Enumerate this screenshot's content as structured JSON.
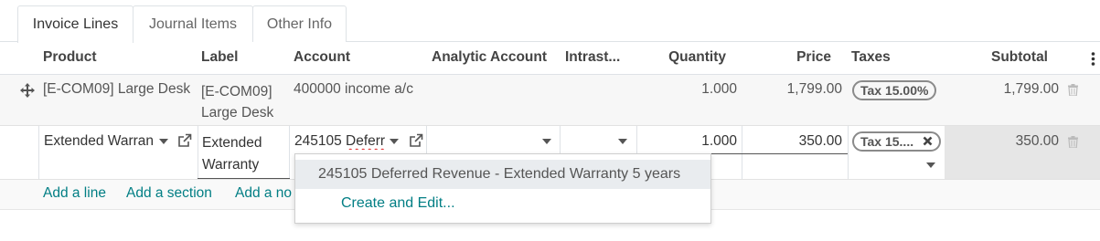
{
  "tabs": [
    {
      "label": "Invoice Lines",
      "active": true
    },
    {
      "label": "Journal Items",
      "active": false
    },
    {
      "label": "Other Info",
      "active": false
    }
  ],
  "columns": {
    "product": "Product",
    "label": "Label",
    "account": "Account",
    "analytic": "Analytic Account",
    "intrastat": "Intrast...",
    "quantity": "Quantity",
    "price": "Price",
    "taxes": "Taxes",
    "subtotal": "Subtotal"
  },
  "rows": [
    {
      "product": "[E-COM09] Large Desk",
      "label_line1": "[E-COM09]",
      "label_line2": "Large Desk",
      "account": "400000 income a/c",
      "quantity": "1.000",
      "price": "1,799.00",
      "tax": "Tax 15.00%",
      "subtotal": "1,799.00"
    },
    {
      "product": "Extended Warran",
      "label_line1": "Extended",
      "label_line2": "Warranty",
      "account_code": "245105 ",
      "account_typed": "Deferr",
      "quantity": "1.000",
      "price": "350.00",
      "tax": "Tax 15....",
      "subtotal": "350.00"
    }
  ],
  "actions": {
    "add_line": "Add a line",
    "add_section": "Add a section",
    "add_note": "Add a no"
  },
  "dropdown": {
    "option": "245105 Deferred Revenue - Extended Warranty 5 years",
    "create_edit": "Create and Edit..."
  },
  "colors": {
    "link": "#017e84",
    "row_hover": "#f7f7f7",
    "subtotal_edit_bg": "#e6e6e6",
    "tag_border": "#8a8a8a"
  },
  "icons": [
    "drag-handle-icon",
    "trash-icon",
    "external-link-icon",
    "chevron-down-icon",
    "remove-tag-icon",
    "column-options-icon"
  ]
}
